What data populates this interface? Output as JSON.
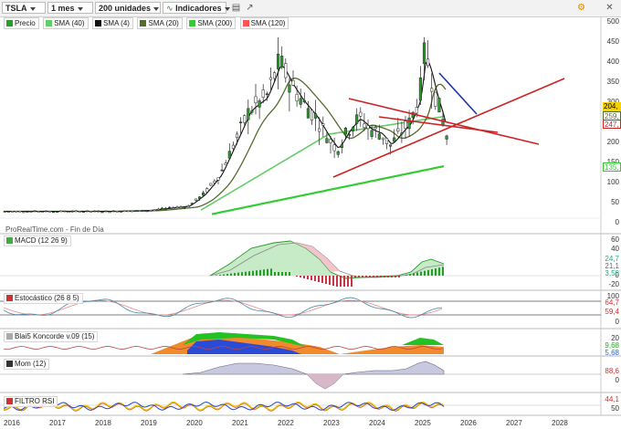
{
  "toolbar": {
    "symbol": "TSLA",
    "period": "1 mes",
    "units": "200 unidades",
    "indicators_label": "Indicadores"
  },
  "legend": {
    "price": "Precio",
    "sma40": "SMA (40)",
    "sma4": "SMA (4)",
    "sma20": "SMA (20)",
    "sma200": "SMA (200)",
    "sma120": "SMA (120)"
  },
  "watermark": "ProRealTime.com - Fin de Día",
  "price_axis": [
    "500",
    "450",
    "400",
    "350",
    "300",
    "250",
    "200",
    "150",
    "100",
    "50",
    "0"
  ],
  "price_boxes": {
    "last": "204,",
    "sma4": "247,",
    "sma20": "259,",
    "sma200": "135,"
  },
  "panels": {
    "macd": {
      "label": "MACD (12 26 9)",
      "ticks": [
        "60",
        "40",
        "20",
        "0",
        "-20"
      ],
      "values": [
        "24,7",
        "21,1",
        "3,58"
      ]
    },
    "stoch": {
      "label": "Estocástico (26 8 5)",
      "ticks": [
        "100",
        "0"
      ],
      "values": [
        "64,7",
        "59,4"
      ]
    },
    "koncorde": {
      "label": "Blai5 Koncorde v.09 (15)",
      "ticks": [
        "20"
      ],
      "values": [
        "9,68",
        "5,68"
      ]
    },
    "mom": {
      "label": "Mom (12)",
      "ticks": [
        "0"
      ],
      "values": [
        "88,6"
      ]
    },
    "rsi": {
      "label": "FILTRO RSI",
      "ticks": [
        "50"
      ],
      "values": [
        "44,1"
      ]
    }
  },
  "x_axis": [
    "2016",
    "2017",
    "2018",
    "2019",
    "2020",
    "2021",
    "2022",
    "2023",
    "2024",
    "2025",
    "2026",
    "2027",
    "2028"
  ],
  "colors": {
    "sma4": "#111111",
    "sma20": "#556b2f",
    "sma40": "#66cc66",
    "sma200": "#33cc33",
    "sma120": "#ff5555",
    "candle_up": "#2e9b2e",
    "candle_down": "#ffffff",
    "trend_red": "#cc2222",
    "trend_blue": "#2233aa"
  }
}
